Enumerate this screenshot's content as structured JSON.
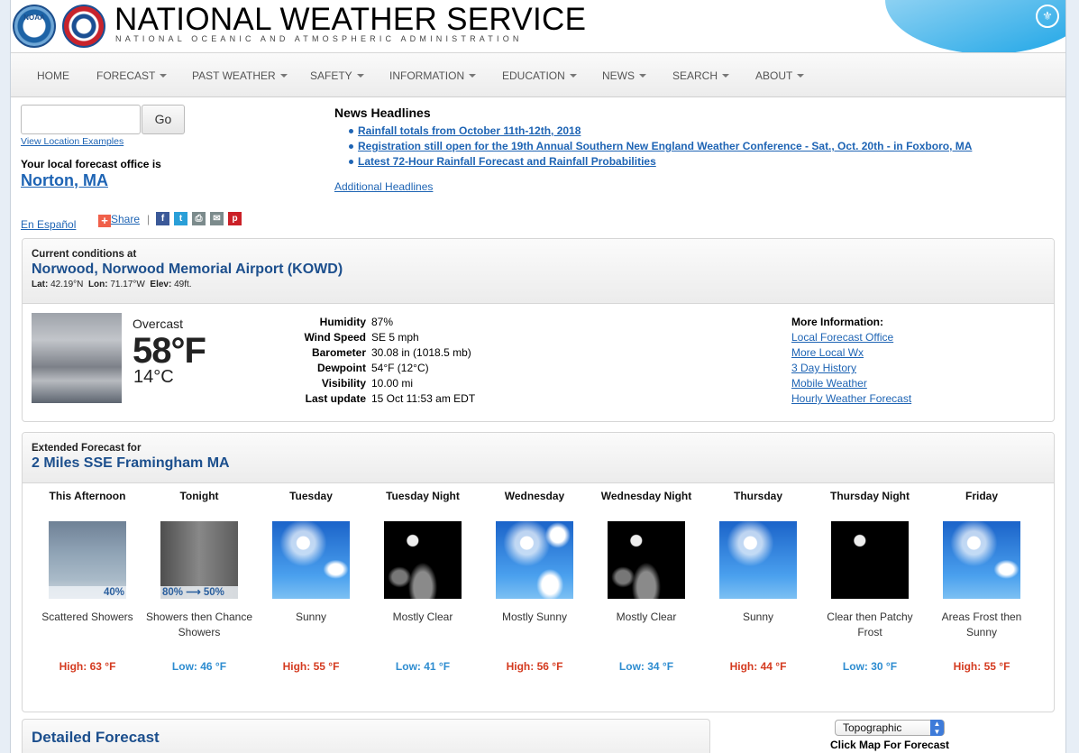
{
  "header": {
    "title": "NATIONAL WEATHER SERVICE",
    "subtitle": "NATIONAL OCEANIC AND ATMOSPHERIC ADMINISTRATION",
    "noaa_logo_text": "NOAA"
  },
  "nav": [
    {
      "label": "HOME",
      "dropdown": false
    },
    {
      "label": "FORECAST",
      "dropdown": true
    },
    {
      "label": "PAST WEATHER",
      "dropdown": true
    },
    {
      "label": "SAFETY",
      "dropdown": true
    },
    {
      "label": "INFORMATION",
      "dropdown": true
    },
    {
      "label": "EDUCATION",
      "dropdown": true
    },
    {
      "label": "NEWS",
      "dropdown": true
    },
    {
      "label": "SEARCH",
      "dropdown": true
    },
    {
      "label": "ABOUT",
      "dropdown": true
    }
  ],
  "location_search": {
    "value": "",
    "button": "Go",
    "examples_link": "View Location Examples",
    "office_label": "Your local forecast office is",
    "office_name": "Norton, MA"
  },
  "social": {
    "espanol": "En Español",
    "share": "Share",
    "separator": "|",
    "icons": [
      "facebook-icon",
      "twitter-icon",
      "print-icon",
      "email-icon",
      "pinterest-icon"
    ]
  },
  "news": {
    "title": "News Headlines",
    "items": [
      "Rainfall totals from October 11th-12th, 2018",
      "Registration still open for the 19th Annual Southern New England Weather Conference - Sat., Oct. 20th - in Foxboro, MA",
      "Latest 72-Hour Rainfall Forecast and Rainfall Probabilities"
    ],
    "additional": "Additional Headlines"
  },
  "current": {
    "label": "Current conditions at",
    "station": "Norwood, Norwood Memorial Airport (KOWD)",
    "lat_label": "Lat:",
    "lat": "42.19°N",
    "lon_label": "Lon:",
    "lon": "71.17°W",
    "elev_label": "Elev:",
    "elev": "49ft.",
    "summary": "Overcast",
    "temp_f": "58°F",
    "temp_c": "14°C",
    "rows": [
      {
        "key": "Humidity",
        "value": "87%"
      },
      {
        "key": "Wind Speed",
        "value": "SE 5 mph"
      },
      {
        "key": "Barometer",
        "value": "30.08 in (1018.5 mb)"
      },
      {
        "key": "Dewpoint",
        "value": "54°F (12°C)"
      },
      {
        "key": "Visibility",
        "value": "10.00 mi"
      },
      {
        "key": "Last update",
        "value": "15 Oct 11:53 am EDT"
      }
    ],
    "more_info_title": "More Information:",
    "more_info_links": [
      "Local Forecast Office",
      "More Local Wx",
      "3 Day History",
      "Mobile Weather",
      "Hourly Weather Forecast"
    ]
  },
  "extended": {
    "label": "Extended Forecast for",
    "location": "2 Miles SSE Framingham MA",
    "periods": [
      {
        "name": "This Afternoon",
        "icon": "showers",
        "pop": "40%",
        "desc": "Scattered Showers",
        "temp": "High: 63 °F",
        "kind": "high"
      },
      {
        "name": "Tonight",
        "icon": "showers-heavy",
        "pop": "80% ⟶ 50%",
        "desc": "Showers then Chance Showers",
        "temp": "Low: 46 °F",
        "kind": "low"
      },
      {
        "name": "Tuesday",
        "icon": "sunny",
        "pop": "",
        "desc": "Sunny",
        "temp": "High: 55 °F",
        "kind": "high"
      },
      {
        "name": "Tuesday Night",
        "icon": "night",
        "pop": "",
        "desc": "Mostly Clear",
        "temp": "Low: 41 °F",
        "kind": "low"
      },
      {
        "name": "Wednesday",
        "icon": "mostly-sunny",
        "pop": "",
        "desc": "Mostly Sunny",
        "temp": "High: 56 °F",
        "kind": "high"
      },
      {
        "name": "Wednesday Night",
        "icon": "night",
        "pop": "",
        "desc": "Mostly Clear",
        "temp": "Low: 34 °F",
        "kind": "low"
      },
      {
        "name": "Thursday",
        "icon": "sunny-clear",
        "pop": "",
        "desc": "Sunny",
        "temp": "High: 44 °F",
        "kind": "high"
      },
      {
        "name": "Thursday Night",
        "icon": "night-clear",
        "pop": "",
        "desc": "Clear then Patchy Frost",
        "temp": "Low: 30 °F",
        "kind": "low"
      },
      {
        "name": "Friday",
        "icon": "partly-sunny",
        "pop": "",
        "desc": "Areas Frost then Sunny",
        "temp": "High: 55 °F",
        "kind": "high"
      }
    ]
  },
  "detailed": {
    "title": "Detailed Forecast"
  },
  "map": {
    "select_value": "Topographic",
    "click_label": "Click Map For Forecast"
  },
  "colors": {
    "high": "#d43a1f",
    "low": "#2d8cd0",
    "heading_blue": "#1c4f8d",
    "link": "#1e64b4"
  }
}
